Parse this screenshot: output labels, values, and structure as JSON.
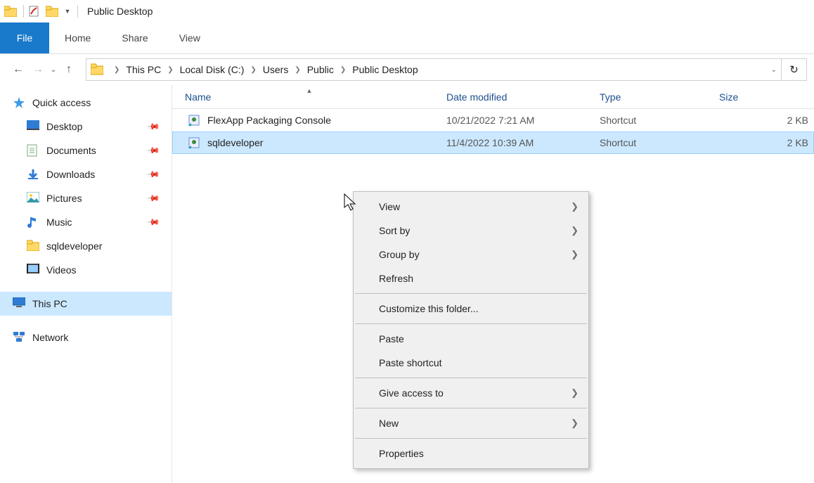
{
  "window": {
    "title": "Public Desktop"
  },
  "ribbon": {
    "file": "File",
    "tabs": [
      "Home",
      "Share",
      "View"
    ]
  },
  "nav": {
    "path": [
      "This PC",
      "Local Disk (C:)",
      "Users",
      "Public",
      "Public Desktop"
    ]
  },
  "navpane": {
    "quick_access": "Quick access",
    "items": [
      {
        "label": "Desktop",
        "pinned": true
      },
      {
        "label": "Documents",
        "pinned": true
      },
      {
        "label": "Downloads",
        "pinned": true
      },
      {
        "label": "Pictures",
        "pinned": true
      },
      {
        "label": "Music",
        "pinned": true
      },
      {
        "label": "sqldeveloper",
        "pinned": false
      },
      {
        "label": "Videos",
        "pinned": false
      }
    ],
    "this_pc": "This PC",
    "network": "Network"
  },
  "columns": {
    "name": "Name",
    "date": "Date modified",
    "type": "Type",
    "size": "Size"
  },
  "files": [
    {
      "name": "FlexApp Packaging Console",
      "date": "10/21/2022 7:21 AM",
      "type": "Shortcut",
      "size": "2 KB",
      "selected": false
    },
    {
      "name": "sqldeveloper",
      "date": "11/4/2022 10:39 AM",
      "type": "Shortcut",
      "size": "2 KB",
      "selected": true
    }
  ],
  "context_menu": {
    "groups": [
      [
        {
          "label": "View",
          "sub": true
        },
        {
          "label": "Sort by",
          "sub": true
        },
        {
          "label": "Group by",
          "sub": true
        },
        {
          "label": "Refresh"
        }
      ],
      [
        {
          "label": "Customize this folder..."
        }
      ],
      [
        {
          "label": "Paste"
        },
        {
          "label": "Paste shortcut"
        }
      ],
      [
        {
          "label": "Give access to",
          "sub": true
        }
      ],
      [
        {
          "label": "New",
          "sub": true
        }
      ],
      [
        {
          "label": "Properties"
        }
      ]
    ]
  }
}
